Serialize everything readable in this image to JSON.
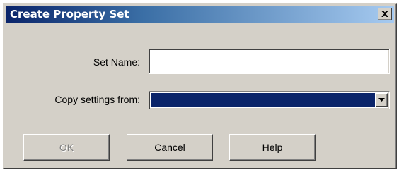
{
  "dialog": {
    "title": "Create Property Set",
    "close_symbol": "×"
  },
  "form": {
    "set_name_label": "Set Name:",
    "set_name_value": "",
    "copy_from_label": "Copy settings from:",
    "copy_from_selected": ""
  },
  "buttons": {
    "ok_label": "OK",
    "ok_enabled": false,
    "cancel_label": "Cancel",
    "help_label": "Help"
  },
  "colors": {
    "title_bar_start": "#0a246a",
    "title_bar_end": "#a6caf0",
    "selection": "#0a246a",
    "face": "#d4d0c8"
  },
  "icons": {
    "close": "close-icon",
    "dropdown": "chevron-down-icon"
  }
}
